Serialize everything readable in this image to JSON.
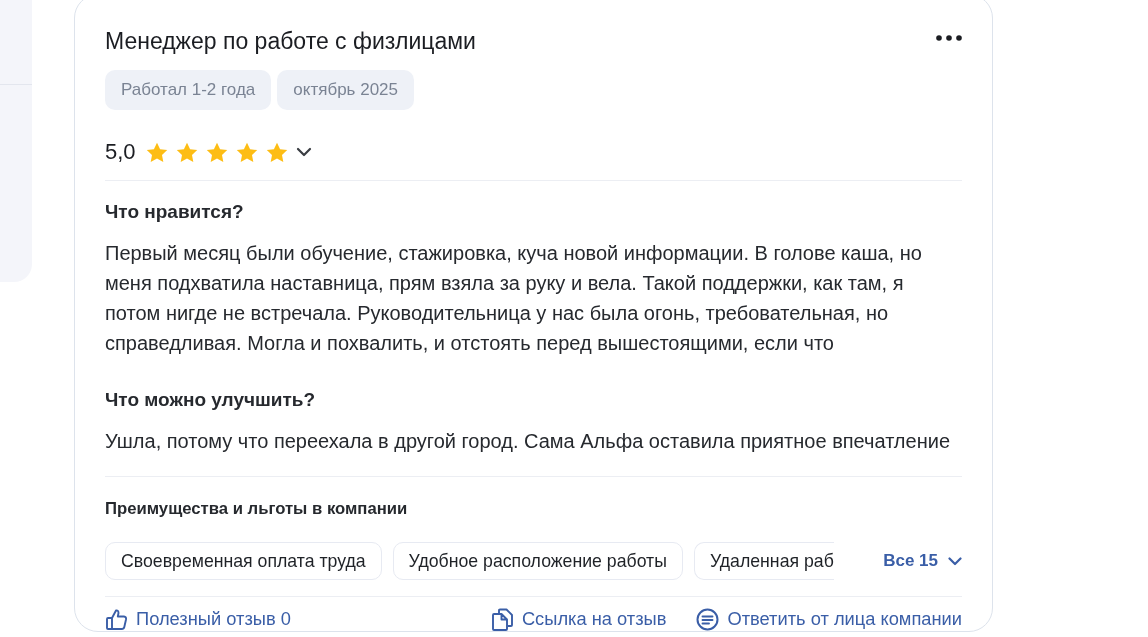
{
  "review": {
    "title": "Менеджер по работе с физлицами",
    "tags": [
      "Работал 1-2 года",
      "октябрь 2025"
    ],
    "rating": {
      "value": "5,0",
      "stars": 5
    },
    "sections": [
      {
        "heading": "Что нравится?",
        "text": "Первый месяц были обучение, стажировка, куча новой информации. В голове каша, но меня подхватила наставница, прям взяла за руку и вела. Такой поддержки, как там, я потом нигде не встречала. Руководительница у нас была огонь, требовательная, но справедливая. Могла и похвалить, и отстоять перед вышестоящими, если что"
      },
      {
        "heading": "Что можно улучшить?",
        "text": "Ушла, потому что переехала в другой город. Сама Альфа оставила приятное впечатление"
      }
    ],
    "benefits": {
      "heading": "Преимущества и льготы в компании",
      "items": [
        "Своевременная оплата труда",
        "Удобное расположение работы",
        "Удаленная раб"
      ],
      "more": "Все 15"
    },
    "actions": [
      {
        "kind": "helpful",
        "label": "Полезный отзыв 0"
      },
      {
        "kind": "link",
        "label": "Ссылка на отзыв"
      },
      {
        "kind": "reply",
        "label": "Ответить от лица компании"
      }
    ]
  }
}
